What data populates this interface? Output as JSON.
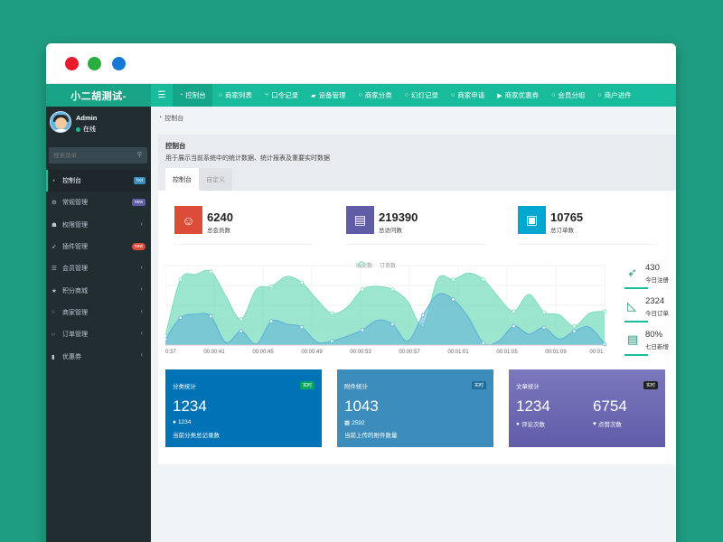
{
  "app": {
    "brand": "小二胡测试-"
  },
  "window_controls": {
    "close": "close",
    "minimize": "minimize",
    "maximize": "maximize"
  },
  "topnav": {
    "toggle_icon": "menu-icon",
    "tabs": [
      {
        "label": "控制台",
        "icon": "dashboard-icon",
        "active": true
      },
      {
        "label": "商家列表",
        "icon": "circle-icon"
      },
      {
        "label": "口令记录",
        "icon": "fork-icon"
      },
      {
        "label": "设备管理",
        "icon": "car-icon"
      },
      {
        "label": "商家分类",
        "icon": "circle-icon"
      },
      {
        "label": "幻灯记录",
        "icon": "circle-icon"
      },
      {
        "label": "商家申请",
        "icon": "circle-icon"
      },
      {
        "label": "商家优惠券",
        "icon": "play-icon"
      },
      {
        "label": "会员分组",
        "icon": "circle-icon"
      },
      {
        "label": "商户进件",
        "icon": "circle-icon"
      }
    ]
  },
  "sidebar": {
    "user": {
      "name": "Admin",
      "status": "在线"
    },
    "search_placeholder": "搜索菜单",
    "items": [
      {
        "label": "控制台",
        "icon": "dashboard-icon",
        "badge": "hot"
      },
      {
        "label": "常规管理",
        "icon": "cogs-icon",
        "badge": "new"
      },
      {
        "label": "权限管理",
        "icon": "group-icon"
      },
      {
        "label": "插件管理",
        "icon": "rocket-icon",
        "badge": "new"
      },
      {
        "label": "会员管理",
        "icon": "list-icon"
      },
      {
        "label": "积分商城",
        "icon": "star-icon"
      },
      {
        "label": "商家管理",
        "icon": "circle-icon"
      },
      {
        "label": "订单管理",
        "icon": "circle-icon"
      },
      {
        "label": "优惠券",
        "icon": "bookmark-icon"
      }
    ]
  },
  "breadcrumb": {
    "label": "控制台"
  },
  "panel": {
    "title": "控制台",
    "description": "用于展示当前系统中的统计数据、统计报表及重要实时数据",
    "tabs": [
      "控制台",
      "自定义"
    ]
  },
  "stats": [
    {
      "value": "6240",
      "label": "总会员数",
      "color": "#dd4b39",
      "icon": "users-icon"
    },
    {
      "value": "219390",
      "label": "总访问数",
      "color": "#605ca8",
      "icon": "book-icon"
    },
    {
      "value": "10765",
      "label": "总订单数",
      "color": "#00a7d0",
      "icon": "shopping-bag-icon"
    }
  ],
  "side_stats": [
    {
      "value": "430",
      "label": "今日注册",
      "icon": "rocket-icon"
    },
    {
      "value": "2324",
      "label": "今日订单",
      "icon": "area-chart-icon"
    },
    {
      "value": "80%",
      "label": "七日新增",
      "icon": "list-alt-icon"
    }
  ],
  "chart_data": {
    "type": "area",
    "legend": [
      "成交数",
      "订单数"
    ],
    "x": [
      "0:37",
      "00:00:41",
      "00:00:45",
      "00:00:49",
      "00:00:53",
      "00:00:57",
      "00:01:01",
      "00:01:05",
      "00:01:09",
      "00:01:"
    ],
    "series": [
      {
        "name": "成交数",
        "color": "#5cb0d8",
        "values": [
          12,
          55,
          62,
          58,
          5,
          28,
          2,
          48,
          42,
          36,
          6,
          8,
          18,
          30,
          50,
          42,
          8,
          60,
          102,
          92,
          56,
          4,
          8,
          38,
          22,
          35,
          12,
          28,
          36,
          2
        ]
      },
      {
        "name": "订单数",
        "color": "#7bdcbd",
        "values": [
          18,
          132,
          142,
          148,
          98,
          52,
          112,
          118,
          138,
          126,
          92,
          64,
          76,
          112,
          118,
          112,
          88,
          40,
          134,
          132,
          145,
          132,
          96,
          68,
          102,
          66,
          61,
          38,
          64,
          68
        ]
      }
    ]
  },
  "cards": [
    {
      "title": "分类统计",
      "tag": "实时",
      "value": "1234",
      "sub_value": "1234",
      "sub_icon": "comment-icon",
      "desc": "当前分类总记录数",
      "color": "#0073b7"
    },
    {
      "title": "附件统计",
      "tag": "实时",
      "value": "1043",
      "sub_value": "2592",
      "sub_icon": "calendar-icon",
      "desc": "当前上传的附件数量",
      "color": "#3c8dbc"
    },
    {
      "title": "文章统计",
      "tag": "实时",
      "value1": "1234",
      "label1": "评论次数",
      "value2": "6754",
      "label2": "点赞次数",
      "color": "#605ca8"
    }
  ]
}
